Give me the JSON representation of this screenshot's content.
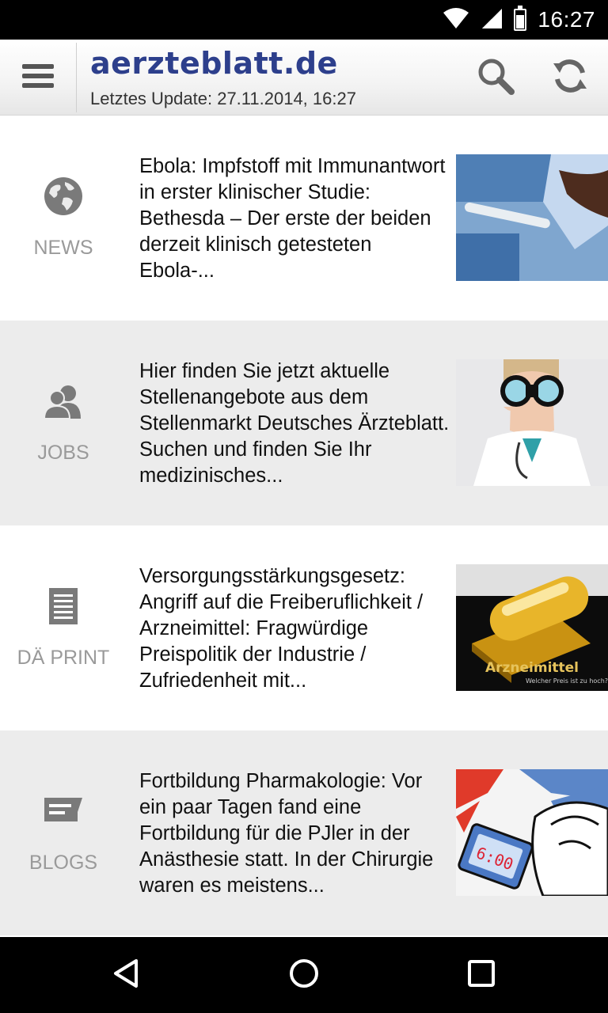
{
  "status_bar": {
    "time": "16:27",
    "icons": [
      "wifi-icon",
      "cell-signal-icon",
      "battery-icon"
    ]
  },
  "header": {
    "brand": "aerzteblatt.de",
    "last_update": "Letztes Update: 27.11.2014, 16:27",
    "brand_color": "#2d3f8c",
    "icons": [
      "menu-icon",
      "search-icon",
      "refresh-icon"
    ]
  },
  "rows": [
    {
      "category": "NEWS",
      "icon": "globe-icon",
      "text": "Ebola: Impfstoff mit Immunantwort in erster klinischer Studie: Bethesda – Der erste der beiden derzeit klinisch getesteten Ebola-..."
    },
    {
      "category": "JOBS",
      "icon": "people-icon",
      "text": "Hier finden Sie jetzt  aktuelle Stellenangebote aus dem Stellenmarkt Deutsches Ärzteblatt. Suchen und finden Sie Ihr medizinisches..."
    },
    {
      "category": "DÄ PRINT",
      "icon": "document-icon",
      "text": "Versorgungsstärkungsgesetz: Angriff auf die Freiberuflichkeit / Arzneimittel: Fragwürdige Preispolitik der Industrie / Zufriedenheit mit...",
      "thumb_caption": "Arzneimittel",
      "thumb_subcaption": "Welcher Preis ist zu hoch?"
    },
    {
      "category": "BLOGS",
      "icon": "comment-icon",
      "text": "Fortbildung Pharmakologie: Vor ein paar Tagen fand eine Fortbildung für die PJler in der Anästhesie statt. In der Chirurgie waren es meistens...",
      "thumb_clock": "6:00"
    }
  ],
  "nav_bar": {
    "icons": [
      "back-icon",
      "home-icon",
      "recents-icon"
    ]
  }
}
